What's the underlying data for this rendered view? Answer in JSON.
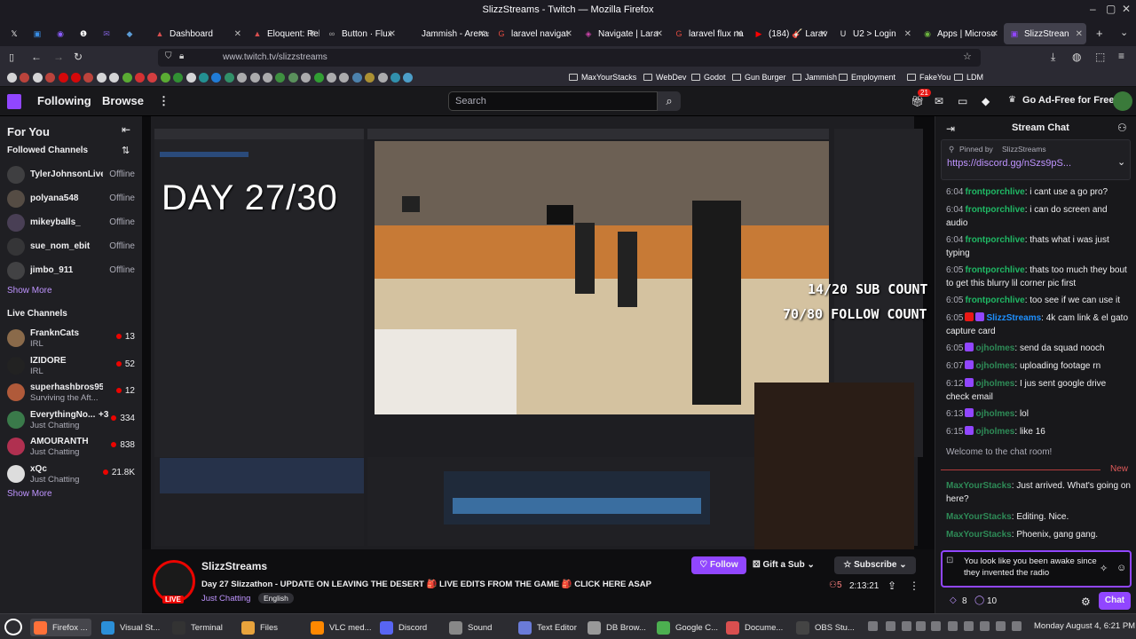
{
  "window": {
    "title": "SlizzStreams - Twitch — Mozilla Firefox"
  },
  "tabs": [
    {
      "label": "",
      "color": "#ffffff",
      "glyph": "𝕏"
    },
    {
      "label": "",
      "color": "#3a8ee6",
      "glyph": "▣"
    },
    {
      "label": "",
      "color": "#8a5cff",
      "glyph": "◉"
    },
    {
      "label": "",
      "color": "#ffffff",
      "glyph": "❶"
    },
    {
      "label": "",
      "color": "#7b5ccf",
      "glyph": "✉"
    },
    {
      "label": "",
      "color": "#5b9bd5",
      "glyph": "◆"
    },
    {
      "label": "Dashboard",
      "color": "#d94f4f",
      "glyph": "▲"
    },
    {
      "label": "Eloquent: Rela",
      "color": "#d94f4f",
      "glyph": "▲"
    },
    {
      "label": "Button · Flux",
      "color": "#aaaaaa",
      "glyph": "∞"
    },
    {
      "label": "Jammish - Arenas",
      "color": "#eeeeee",
      "glyph": ""
    },
    {
      "label": "laravel navigat",
      "color": "#e04a3f",
      "glyph": "G"
    },
    {
      "label": "Navigate | Lara",
      "color": "#cc44aa",
      "glyph": "◈"
    },
    {
      "label": "laravel flux na",
      "color": "#e04a3f",
      "glyph": "G"
    },
    {
      "label": "(184) 🎸 Larav",
      "color": "#ff0000",
      "glyph": "▶"
    },
    {
      "label": "U2 > Login",
      "color": "#eeeeee",
      "glyph": "U"
    },
    {
      "label": "Apps | Microso",
      "color": "#6cb33f",
      "glyph": "◉"
    },
    {
      "label": "SlizzStrean",
      "color": "#9146ff",
      "glyph": "▣",
      "active": true
    }
  ],
  "address": {
    "url": "www.twitch.tv/slizzstreams"
  },
  "bookmarks": [
    "MaxYourStacks",
    "WebDev",
    "Godot",
    "Gun Burger",
    "Jammish",
    "Employment",
    "FakeYou",
    "LDM"
  ],
  "twitch": {
    "nav": {
      "following": "Following",
      "browse": "Browse",
      "more": "⋮"
    },
    "search_placeholder": "Search",
    "notif_count": "21",
    "ad_free": "Go Ad-Free for Free"
  },
  "sidebar": {
    "for_you": "For You",
    "followed_title": "Followed Channels",
    "followed": [
      {
        "name": "TylerJohnsonLive",
        "status": "Offline",
        "color": "#555"
      },
      {
        "name": "polyana548",
        "status": "Offline",
        "color": "#7a6a5a"
      },
      {
        "name": "mikeyballs_",
        "status": "Offline",
        "color": "#665577"
      },
      {
        "name": "sue_nom_ebit",
        "status": "Offline",
        "color": "#444"
      },
      {
        "name": "jimbo_911",
        "status": "Offline",
        "color": "#5a5a5a"
      }
    ],
    "show_more_1": "Show More",
    "live_title": "Live Channels",
    "live": [
      {
        "name": "FranknCats",
        "category": "IRL",
        "viewers": "13",
        "color": "#8a6a4a"
      },
      {
        "name": "IZIDORE",
        "category": "IRL",
        "viewers": "52",
        "color": "#222"
      },
      {
        "name": "superhashbros95",
        "category": "Surviving the Aft...",
        "viewers": "12",
        "color": "#b05a3a"
      },
      {
        "name": "EverythingNo...",
        "extra": "+3",
        "category": "Just Chatting",
        "viewers": "334",
        "color": "#3a7a4a"
      },
      {
        "name": "AMOURANTH",
        "category": "Just Chatting",
        "viewers": "838",
        "color": "#b03050"
      },
      {
        "name": "xQc",
        "category": "Just Chatting",
        "viewers": "21.8K",
        "color": "#dddddd"
      }
    ],
    "show_more_2": "Show More"
  },
  "video": {
    "day_text": "DAY 27/30",
    "sub_count": "14/20 SUB COUNT",
    "follow_count": "70/80 FOLLOW COUNT"
  },
  "stream": {
    "channel": "SlizzStreams",
    "live_badge": "LIVE",
    "title": "Day 27 Slizzathon - UPDATE ON LEAVING THE DESERT 🎒 LIVE EDITS FROM THE GAME 🎒 CLICK HERE ASAP",
    "category": "Just Chatting",
    "language": "English",
    "follow_label": "Follow",
    "gift_label": "Gift a Sub",
    "subscribe_label": "Subscribe",
    "viewers": "5",
    "uptime": "2:13:21"
  },
  "chat": {
    "title": "Stream Chat",
    "pinned_by": "Pinned by",
    "pinned_user": "SlizzStreams",
    "pinned_link": "https://discord.gg/nSzs9pS...",
    "messages": [
      {
        "time": "6:04",
        "user": "frontporchlive",
        "text": "i cant use a go pro?",
        "cls": ""
      },
      {
        "time": "6:04",
        "user": "frontporchlive",
        "text": "i can do screen and audio",
        "cls": ""
      },
      {
        "time": "6:04",
        "user": "frontporchlive",
        "text": "thats what i was just typing",
        "cls": ""
      },
      {
        "time": "6:05",
        "user": "frontporchlive",
        "text": "thats too much they bout to get this blurry lil corner pic first",
        "cls": ""
      },
      {
        "time": "6:05",
        "user": "frontporchlive",
        "text": "too see if we can use it",
        "cls": ""
      },
      {
        "time": "6:05",
        "user": "SlizzStreams",
        "text": "4k cam link & el gato capture card",
        "cls": "u3"
      },
      {
        "time": "6:05",
        "user": "ojholmes",
        "text": "send da squad nooch",
        "cls": "u4"
      },
      {
        "time": "6:07",
        "user": "ojholmes",
        "text": "uploading footage rn",
        "cls": "u4"
      },
      {
        "time": "6:12",
        "user": "ojholmes",
        "text": "I jus sent google drive check email",
        "cls": "u4"
      },
      {
        "time": "6:13",
        "user": "ojholmes",
        "text": "lol",
        "cls": "u4"
      },
      {
        "time": "6:15",
        "user": "ojholmes",
        "text": "like 16",
        "cls": "u4"
      }
    ],
    "welcome": "Welcome to the chat room!",
    "new_label": "New",
    "local": [
      {
        "user": "MaxYourStacks",
        "text": "Just arrived. What's going on here?"
      },
      {
        "user": "MaxYourStacks",
        "text": "Editing. Nice."
      },
      {
        "user": "MaxYourStacks",
        "text": "Phoenix, gang gang."
      }
    ],
    "input_value": "You look like you been awake since they invented the radio",
    "points": "8",
    "bits": "10",
    "chat_button": "Chat"
  },
  "taskbar": {
    "items": [
      {
        "label": "Firefox ...",
        "color": "#ff7139",
        "active": true
      },
      {
        "label": "Visual St...",
        "color": "#2b8fd8"
      },
      {
        "label": "Terminal",
        "color": "#333333"
      },
      {
        "label": "Files",
        "color": "#e8a33c"
      },
      {
        "label": "VLC med...",
        "color": "#ff8800"
      },
      {
        "label": "Discord",
        "color": "#5865f2"
      },
      {
        "label": "Sound",
        "color": "#888888"
      },
      {
        "label": "Text Editor",
        "color": "#6a7bd8"
      },
      {
        "label": "DB Brow...",
        "color": "#999999"
      },
      {
        "label": "Google C...",
        "color": "#4caf50"
      },
      {
        "label": "Docume...",
        "color": "#d94f4f"
      },
      {
        "label": "OBS Stu...",
        "color": "#444444"
      }
    ],
    "clock": "Monday August 4, 6:21 PM"
  }
}
